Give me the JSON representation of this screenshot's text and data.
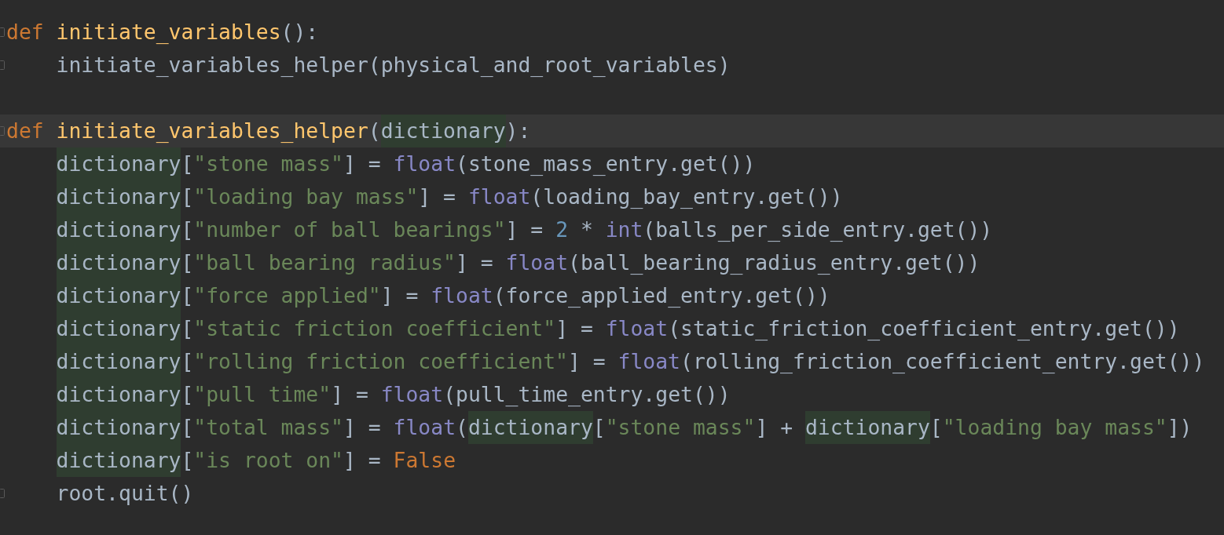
{
  "lines": [
    {
      "fold": true,
      "current": false,
      "tokens": [
        {
          "kind": "keyword",
          "text": "def"
        },
        {
          "kind": "function",
          "text": "initiate_variables"
        },
        {
          "kind": "plain",
          "text": "():"
        }
      ],
      "children": [
        {
          "fold": true,
          "current": false,
          "tokens": [
            {
              "kind": "plain",
              "text": "initiate_variables_helper(physical_and_root_variables)"
            }
          ]
        }
      ]
    },
    {
      "fold": false,
      "current": false
    },
    {
      "fold": true,
      "current": true,
      "tokens": [
        {
          "kind": "keyword",
          "text": "def"
        },
        {
          "kind": "function",
          "text": "initiate_variables_helper"
        },
        {
          "kind": "plain",
          "text": "("
        },
        {
          "kind": "highlight",
          "text": "dictionary"
        },
        {
          "kind": "plain",
          "text": "):"
        }
      ],
      "children": [
        {
          "fold": false,
          "current": false,
          "tokens": [
            {
              "kind": "highlight",
              "text": "dictionary"
            },
            {
              "kind": "plain",
              "text": "["
            },
            {
              "kind": "string",
              "text": "\"stone mass\""
            },
            {
              "kind": "plain",
              "text": "] = "
            },
            {
              "kind": "builtin",
              "text": "float"
            },
            {
              "kind": "plain",
              "text": "(stone_mass_entry.get())"
            }
          ]
        },
        {
          "fold": false,
          "current": false,
          "tokens": [
            {
              "kind": "highlight",
              "text": "dictionary"
            },
            {
              "kind": "plain",
              "text": "["
            },
            {
              "kind": "string",
              "text": "\"loading bay mass\""
            },
            {
              "kind": "plain",
              "text": "] = "
            },
            {
              "kind": "builtin",
              "text": "float"
            },
            {
              "kind": "plain",
              "text": "(loading_bay_entry.get())"
            }
          ]
        },
        {
          "fold": false,
          "current": false,
          "tokens": [
            {
              "kind": "highlight",
              "text": "dictionary"
            },
            {
              "kind": "plain",
              "text": "["
            },
            {
              "kind": "string",
              "text": "\"number of ball bearings\""
            },
            {
              "kind": "plain",
              "text": "] = "
            },
            {
              "kind": "number",
              "text": "2"
            },
            {
              "kind": "plain",
              "text": " * "
            },
            {
              "kind": "builtin",
              "text": "int"
            },
            {
              "kind": "plain",
              "text": "(balls_per_side_entry.get())"
            }
          ]
        },
        {
          "fold": false,
          "current": false,
          "tokens": [
            {
              "kind": "highlight",
              "text": "dictionary"
            },
            {
              "kind": "plain",
              "text": "["
            },
            {
              "kind": "string",
              "text": "\"ball bearing radius\""
            },
            {
              "kind": "plain",
              "text": "] = "
            },
            {
              "kind": "builtin",
              "text": "float"
            },
            {
              "kind": "plain",
              "text": "(ball_bearing_radius_entry.get())"
            }
          ]
        },
        {
          "fold": false,
          "current": false,
          "tokens": [
            {
              "kind": "highlight",
              "text": "dictionary"
            },
            {
              "kind": "plain",
              "text": "["
            },
            {
              "kind": "string",
              "text": "\"force applied\""
            },
            {
              "kind": "plain",
              "text": "] = "
            },
            {
              "kind": "builtin",
              "text": "float"
            },
            {
              "kind": "plain",
              "text": "(force_applied_entry.get())"
            }
          ]
        },
        {
          "fold": false,
          "current": false,
          "tokens": [
            {
              "kind": "highlight",
              "text": "dictionary"
            },
            {
              "kind": "plain",
              "text": "["
            },
            {
              "kind": "string",
              "text": "\"static friction coefficient\""
            },
            {
              "kind": "plain",
              "text": "] = "
            },
            {
              "kind": "builtin",
              "text": "float"
            },
            {
              "kind": "plain",
              "text": "(static_friction_coefficient_entry.get())"
            }
          ]
        },
        {
          "fold": false,
          "current": false,
          "tokens": [
            {
              "kind": "highlight",
              "text": "dictionary"
            },
            {
              "kind": "plain",
              "text": "["
            },
            {
              "kind": "string",
              "text": "\"rolling friction coefficient\""
            },
            {
              "kind": "plain",
              "text": "] = "
            },
            {
              "kind": "builtin",
              "text": "float"
            },
            {
              "kind": "plain",
              "text": "(rolling_friction_coefficient_entry.get())"
            }
          ]
        },
        {
          "fold": false,
          "current": false,
          "tokens": [
            {
              "kind": "highlight",
              "text": "dictionary"
            },
            {
              "kind": "plain",
              "text": "["
            },
            {
              "kind": "string",
              "text": "\"pull time\""
            },
            {
              "kind": "plain",
              "text": "] = "
            },
            {
              "kind": "builtin",
              "text": "float"
            },
            {
              "kind": "plain",
              "text": "(pull_time_entry.get())"
            }
          ]
        },
        {
          "fold": false,
          "current": false,
          "tokens": [
            {
              "kind": "highlight",
              "text": "dictionary"
            },
            {
              "kind": "plain",
              "text": "["
            },
            {
              "kind": "string",
              "text": "\"total mass\""
            },
            {
              "kind": "plain",
              "text": "] = "
            },
            {
              "kind": "builtin",
              "text": "float"
            },
            {
              "kind": "plain",
              "text": "("
            },
            {
              "kind": "highlight",
              "text": "dictionary"
            },
            {
              "kind": "plain",
              "text": "["
            },
            {
              "kind": "string",
              "text": "\"stone mass\""
            },
            {
              "kind": "plain",
              "text": "] + "
            },
            {
              "kind": "highlight",
              "text": "dictionary"
            },
            {
              "kind": "plain",
              "text": "["
            },
            {
              "kind": "string",
              "text": "\"loading bay mass\""
            },
            {
              "kind": "plain",
              "text": "])"
            }
          ]
        },
        {
          "fold": false,
          "current": false,
          "tokens": [
            {
              "kind": "highlight",
              "text": "dictionary"
            },
            {
              "kind": "plain",
              "text": "["
            },
            {
              "kind": "string",
              "text": "\"is root on\""
            },
            {
              "kind": "plain",
              "text": "] = "
            },
            {
              "kind": "keyword",
              "text": "False"
            }
          ]
        },
        {
          "fold": true,
          "current": false,
          "tokens": [
            {
              "kind": "plain",
              "text": "root.quit()"
            }
          ]
        }
      ]
    }
  ]
}
